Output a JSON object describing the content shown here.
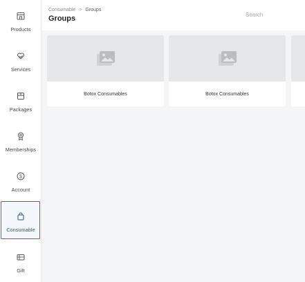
{
  "sidebar": {
    "items": [
      {
        "label": "Products",
        "icon": "store-icon"
      },
      {
        "label": "Services",
        "icon": "heart-hand-icon"
      },
      {
        "label": "Packages",
        "icon": "package-icon"
      },
      {
        "label": "Memberships",
        "icon": "badge-icon"
      },
      {
        "label": "Account",
        "icon": "dollar-circle-icon"
      },
      {
        "label": "Consumable",
        "icon": "bag-icon",
        "active": true
      },
      {
        "label": "Gift",
        "icon": "gift-card-icon"
      }
    ]
  },
  "header": {
    "breadcrumb": {
      "parent": "Consumable",
      "separator": ">",
      "current": "Groups"
    },
    "title": "Groups",
    "search_placeholder": "Search"
  },
  "cards": [
    {
      "title": "Botox Consumables",
      "image_icon": "image-placeholder-icon"
    },
    {
      "title": "Botox Consumables",
      "image_icon": "image-placeholder-icon"
    }
  ],
  "colors": {
    "active_highlight": "#d8342d",
    "active_label": "#1f5e7a",
    "background": "#f4f5f7"
  }
}
